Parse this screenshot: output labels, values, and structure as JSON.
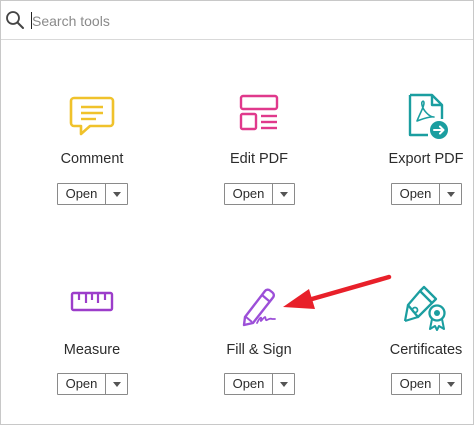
{
  "search": {
    "placeholder": "Search tools",
    "value": ""
  },
  "tools": [
    {
      "label": "Comment",
      "icon": "comment-icon",
      "open_label": "Open"
    },
    {
      "label": "Edit PDF",
      "icon": "edit-pdf-icon",
      "open_label": "Open"
    },
    {
      "label": "Export PDF",
      "icon": "export-pdf-icon",
      "open_label": "Open"
    },
    {
      "label": "Measure",
      "icon": "measure-ruler-icon",
      "open_label": "Open"
    },
    {
      "label": "Fill & Sign",
      "icon": "fill-sign-pen-icon",
      "open_label": "Open"
    },
    {
      "label": "Certificates",
      "icon": "certificates-pen-icon",
      "open_label": "Open"
    }
  ],
  "annotation": {
    "icon": "red-arrow-pointer",
    "color": "#e8202a"
  },
  "colors": {
    "comment": "#f0c22b",
    "edit_pdf": "#e0398c",
    "export_pdf": "#1b9ea0",
    "measure": "#9c3dca",
    "fill_sign": "#9c4fd8",
    "certificates": "#1b9ea0"
  }
}
